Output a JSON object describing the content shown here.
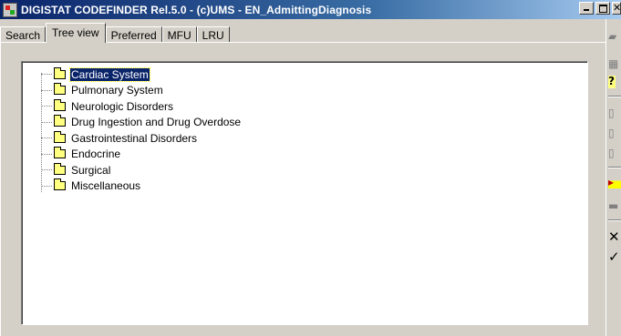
{
  "window": {
    "title": "DIGISTAT CODEFINDER Rel.5.0 - (c)UMS - EN_AdmittingDiagnosis"
  },
  "tabs": [
    {
      "label": "Search"
    },
    {
      "label": "Tree view"
    },
    {
      "label": "Preferred"
    },
    {
      "label": "MFU"
    },
    {
      "label": "LRU"
    }
  ],
  "active_tab": "Tree view",
  "tree": {
    "items": [
      {
        "label": "Cardiac System",
        "selected": true
      },
      {
        "label": "Pulmonary System"
      },
      {
        "label": "Neurologic Disorders"
      },
      {
        "label": "Drug Ingestion and Drug Overdose"
      },
      {
        "label": "Gastrointestinal Disorders"
      },
      {
        "label": "Endocrine"
      },
      {
        "label": "Surgical"
      },
      {
        "label": "Miscellaneous"
      }
    ]
  },
  "toolbar": {
    "icons": [
      "open-folder-icon",
      "properties-icon",
      "help-icon",
      "edit-icon",
      "paste-icon",
      "copy-icon",
      "new-folder-icon",
      "delete-folder-icon",
      "cancel-icon",
      "ok-icon"
    ],
    "glyphs": {
      "cancel": "✕",
      "ok": "✓",
      "help": "?"
    }
  },
  "colors": {
    "title_start": "#0a246a",
    "title_end": "#a6caf0",
    "selection": "#0a246a",
    "folder": "#ffff80",
    "window_bg": "#d4d0c8"
  }
}
